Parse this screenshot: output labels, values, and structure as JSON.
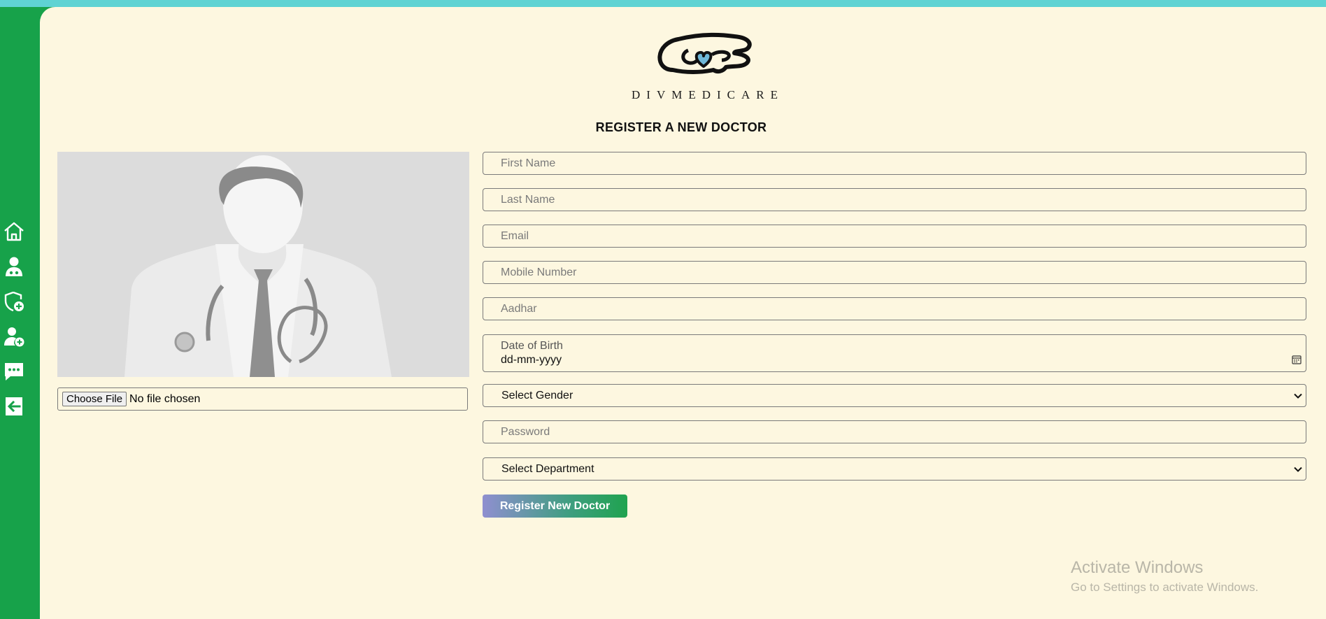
{
  "app": {
    "brand": "DIVMEDICARE"
  },
  "sidebar": {
    "items": [
      {
        "name": "home",
        "icon": "home-icon"
      },
      {
        "name": "doctors",
        "icon": "doctor-icon"
      },
      {
        "name": "add-admin",
        "icon": "shield-plus-icon"
      },
      {
        "name": "add-doctor",
        "icon": "user-plus-icon"
      },
      {
        "name": "messages",
        "icon": "chat-icon"
      },
      {
        "name": "logout",
        "icon": "logout-icon"
      }
    ]
  },
  "page": {
    "title": "REGISTER A NEW DOCTOR"
  },
  "photo": {
    "button_label": "Choose File",
    "status": "No file chosen"
  },
  "form": {
    "first_name": {
      "placeholder": "First Name",
      "value": ""
    },
    "last_name": {
      "placeholder": "Last Name",
      "value": ""
    },
    "email": {
      "placeholder": "Email",
      "value": ""
    },
    "mobile": {
      "placeholder": "Mobile Number",
      "value": ""
    },
    "aadhar": {
      "placeholder": "Aadhar",
      "value": ""
    },
    "dob": {
      "label": "Date of Birth",
      "value": "dd-mm-yyyy"
    },
    "gender": {
      "selected": "Select Gender"
    },
    "password": {
      "placeholder": "Password",
      "value": ""
    },
    "department": {
      "selected": "Select Department"
    },
    "submit_label": "Register New Doctor"
  },
  "watermark": {
    "title": "Activate Windows",
    "subtitle": "Go to Settings to activate Windows."
  },
  "colors": {
    "sidebar": "#17a24a",
    "top_strip": "#5fd3d3",
    "background": "#fdf7e0",
    "button_gradient_start": "#8f8fd0",
    "button_gradient_end": "#1fa34f",
    "logo_heart": "#6fb8d8"
  }
}
